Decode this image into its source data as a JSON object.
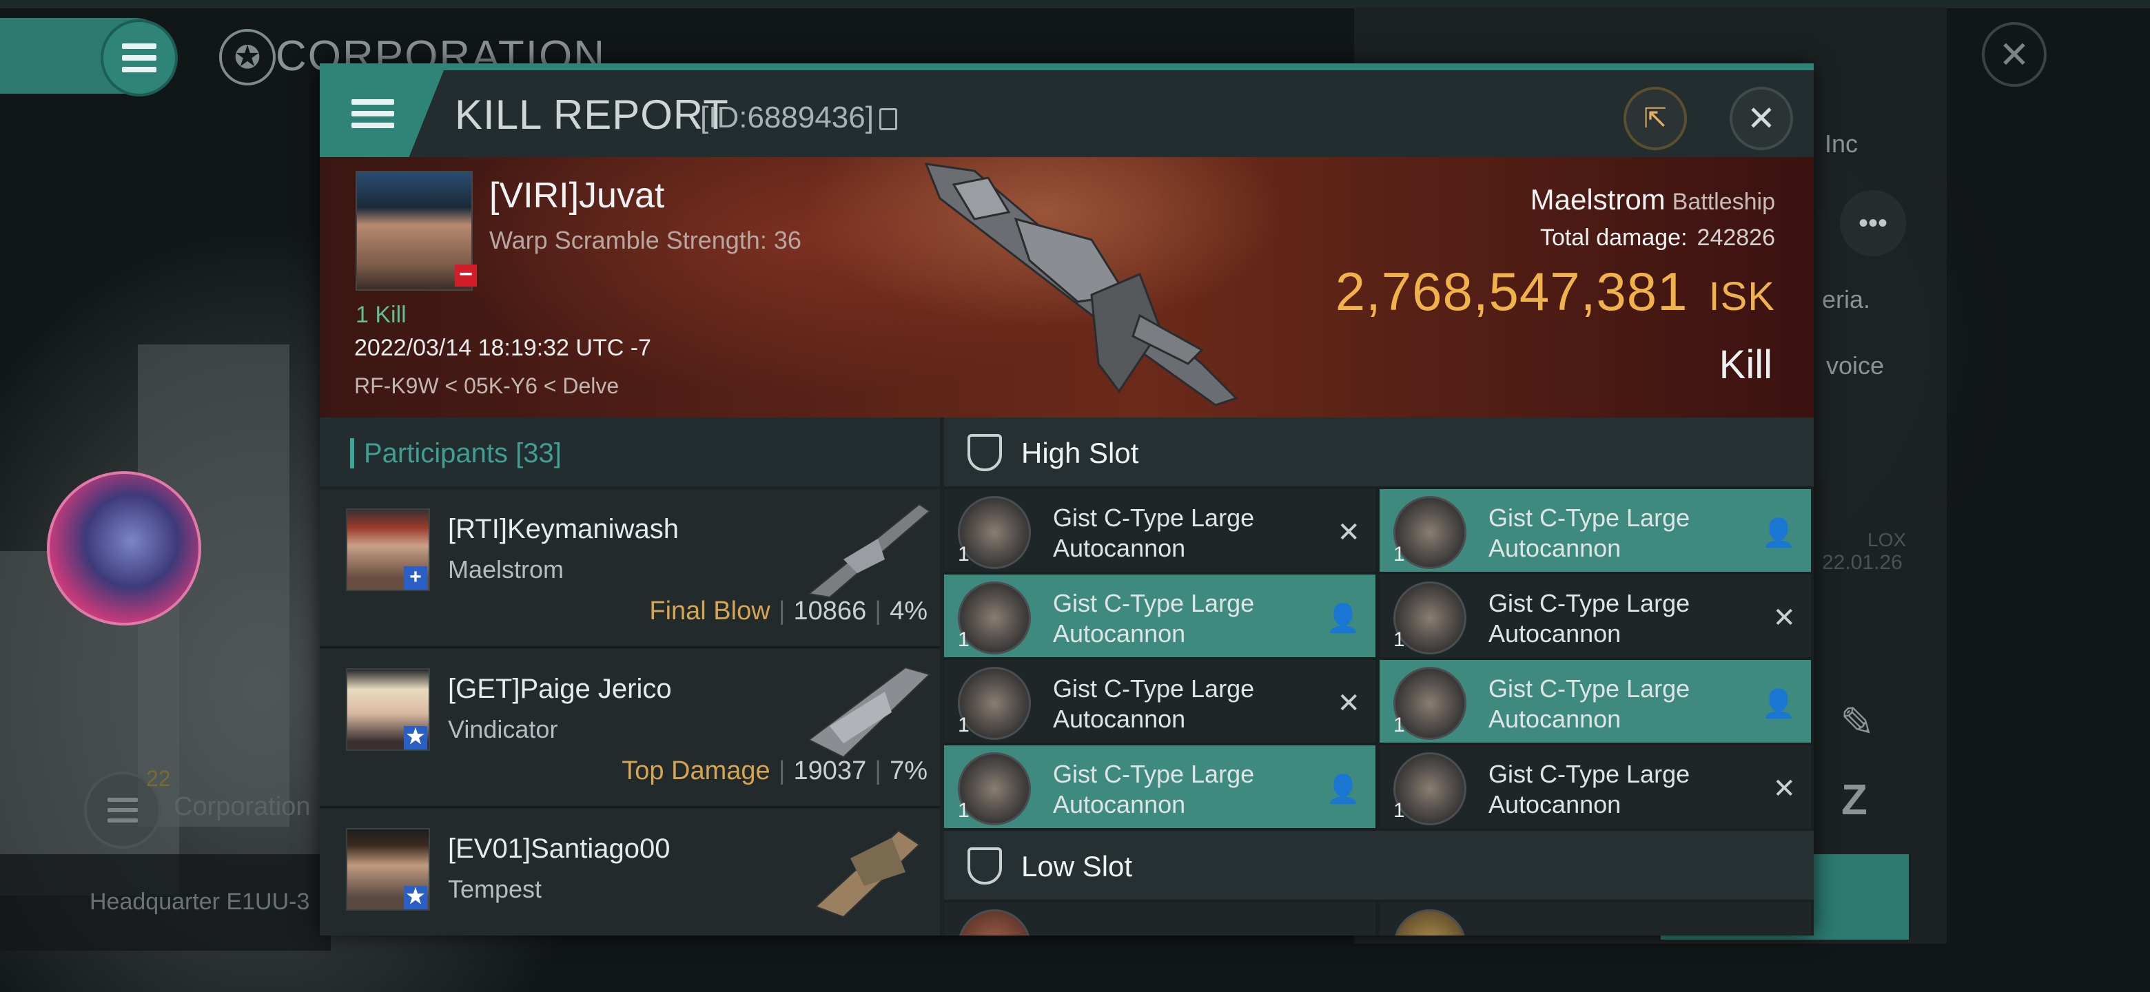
{
  "background": {
    "corp_title": "CORPORATION",
    "corp_name_partial": "Inc",
    "desc_partial_1": "eria.",
    "desc_partial_2": "voice",
    "timestamp_1": "LOX",
    "timestamp_2": "22.01.26",
    "corp_button_count": "22",
    "corp_button_label": "Corporation",
    "headquarter_label": "Headquarter E1UU-3"
  },
  "window": {
    "title": "KILL REPORT",
    "id_label": "[ID:6889436]"
  },
  "victim": {
    "name": "[VIRI]Juvat",
    "warp_scramble": "Warp Scramble Strength: 36",
    "kills": "1 Kill",
    "datetime": "2022/03/14 18:19:32 UTC -7",
    "location": "RF-K9W < 05K-Y6 < Delve",
    "ship_name": "Maelstrom",
    "ship_class": "Battleship",
    "total_damage_label": "Total damage:",
    "total_damage_value": "242826",
    "isk_value": "2,768,547,381",
    "isk_unit": "ISK",
    "result": "Kill"
  },
  "participants": {
    "label": "Participants",
    "count": "[33]",
    "items": [
      {
        "name": "[RTI]Keymaniwash",
        "ship": "Maelstrom",
        "role": "Final Blow",
        "damage": "10866",
        "percent": "4%"
      },
      {
        "name": "[GET]Paige Jerico",
        "ship": "Vindicator",
        "role": "Top Damage",
        "damage": "19037",
        "percent": "7%"
      },
      {
        "name": "[EV01]Santiago00",
        "ship": "Tempest",
        "role": "",
        "damage": "",
        "percent": ""
      }
    ]
  },
  "slots": {
    "high_slot_label": "High Slot",
    "low_slot_label": "Low Slot",
    "high_modules": [
      {
        "name_line1": "Gist C-Type Large",
        "name_line2": "Autocannon",
        "qty": "1",
        "status": "destroyed"
      },
      {
        "name_line1": "Gist C-Type Large",
        "name_line2": "Autocannon",
        "qty": "1",
        "status": "dropped"
      },
      {
        "name_line1": "Gist C-Type Large",
        "name_line2": "Autocannon",
        "qty": "1",
        "status": "dropped"
      },
      {
        "name_line1": "Gist C-Type Large",
        "name_line2": "Autocannon",
        "qty": "1",
        "status": "destroyed"
      },
      {
        "name_line1": "Gist C-Type Large",
        "name_line2": "Autocannon",
        "qty": "1",
        "status": "destroyed"
      },
      {
        "name_line1": "Gist C-Type Large",
        "name_line2": "Autocannon",
        "qty": "1",
        "status": "dropped"
      },
      {
        "name_line1": "Gist C-Type Large",
        "name_line2": "Autocannon",
        "qty": "1",
        "status": "dropped"
      },
      {
        "name_line1": "Gist C-Type Large",
        "name_line2": "Autocannon",
        "qty": "1",
        "status": "destroyed"
      }
    ]
  },
  "colors": {
    "accent_teal": "#2f8478",
    "isk_gold": "#f0b24a",
    "dropped_bg": "#3f8a7e",
    "destroyed_bg": "#1f2628"
  }
}
